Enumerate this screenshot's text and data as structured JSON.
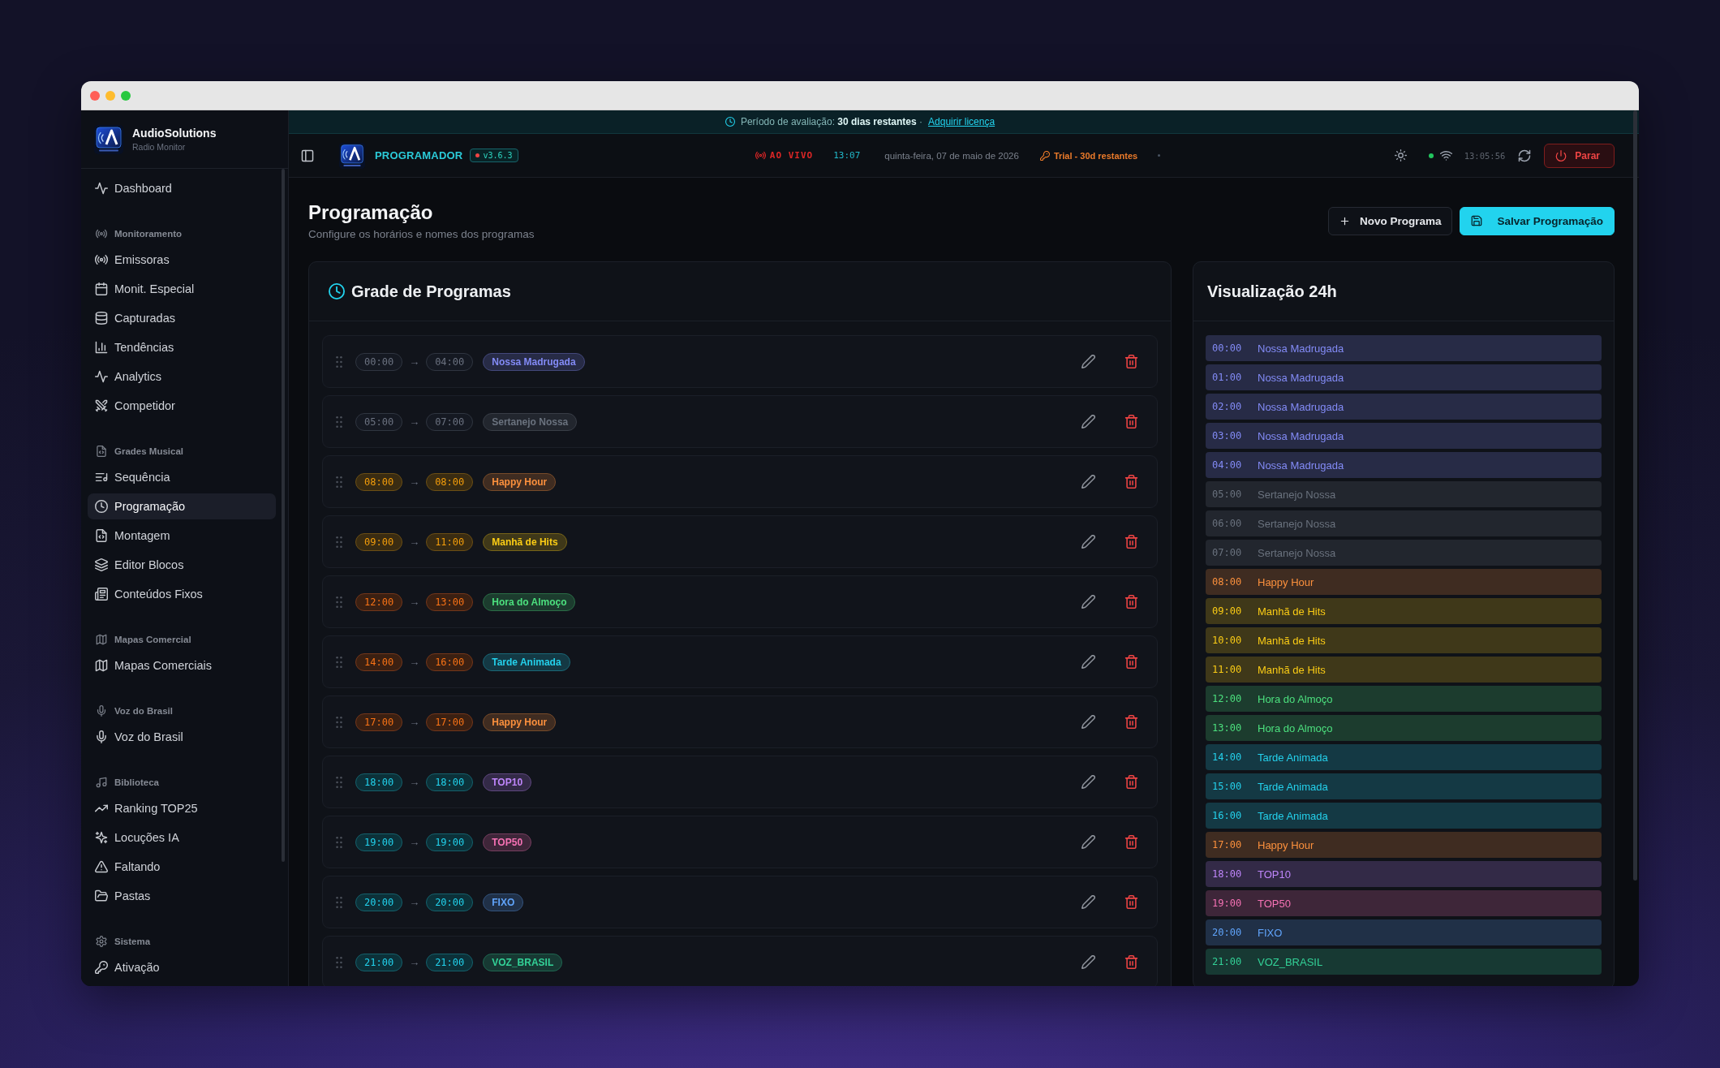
{
  "sidebar": {
    "brand": {
      "name": "AudioSolutions",
      "subtitle": "Radio Monitor"
    },
    "groups": [
      {
        "items": [
          {
            "label": "Dashboard",
            "selected": false
          }
        ]
      },
      {
        "heading": "Monitoramento",
        "items": [
          {
            "label": "Emissoras",
            "selected": false
          },
          {
            "label": "Monit. Especial",
            "selected": false
          },
          {
            "label": "Capturadas",
            "selected": false
          },
          {
            "label": "Tendências",
            "selected": false
          },
          {
            "label": "Analytics",
            "selected": false
          },
          {
            "label": "Competidor",
            "selected": false
          }
        ]
      },
      {
        "heading": "Grades Musical",
        "items": [
          {
            "label": "Sequência",
            "selected": false
          },
          {
            "label": "Programação",
            "selected": true
          },
          {
            "label": "Montagem",
            "selected": false
          },
          {
            "label": "Editor Blocos",
            "selected": false
          },
          {
            "label": "Conteúdos Fixos",
            "selected": false
          }
        ]
      },
      {
        "heading": "Mapas Comercial",
        "items": [
          {
            "label": "Mapas Comerciais",
            "selected": false
          }
        ]
      },
      {
        "heading": "Voz do Brasil",
        "items": [
          {
            "label": "Voz do Brasil",
            "selected": false
          }
        ]
      },
      {
        "heading": "Biblioteca",
        "items": [
          {
            "label": "Ranking TOP25",
            "selected": false
          },
          {
            "label": "Locuções IA",
            "selected": false
          },
          {
            "label": "Faltando",
            "selected": false
          },
          {
            "label": "Pastas",
            "selected": false
          }
        ]
      },
      {
        "heading": "Sistema",
        "items": [
          {
            "label": "Ativação",
            "selected": false
          }
        ]
      }
    ]
  },
  "trial_banner": {
    "message": "Período de avaliação: **30 dias restantes** ·",
    "link": "Adquirir licença"
  },
  "header": {
    "app_name": "PROGRAMADOR",
    "version": "v3.6.3",
    "live_label": "AO VIVO",
    "live_time": "13:07",
    "date": "quinta-feira, 07 de maio de 2026",
    "trial": "Trial - 30d restantes",
    "online": true,
    "clock": "13:05:56",
    "stop_button": "Parar"
  },
  "page": {
    "title": "Programação",
    "subtitle": "Configure os horários e nomes dos programas",
    "actions": [
      {
        "label": "Novo Programa",
        "kind": "outline"
      },
      {
        "label": "Salvar Programação",
        "kind": "filled"
      }
    ]
  },
  "schedule": {
    "title": "Grade de Programas",
    "rows": [
      {
        "start": "00:00",
        "arrow": "→",
        "end": "04:00",
        "program": "Nossa Madrugada",
        "kind": "dawn",
        "color": "#272b46"
      },
      {
        "start": "05:00",
        "arrow": "→",
        "end": "07:00",
        "program": "Sertanejo Nossa",
        "kind": "dawn",
        "color": "#22262e"
      },
      {
        "start": "08:00",
        "arrow": "→",
        "end": "08:00",
        "program": "Happy Hour",
        "kind": "morning",
        "color": "#3f2c21"
      },
      {
        "start": "09:00",
        "arrow": "→",
        "end": "11:00",
        "program": "Manhã de Hits",
        "kind": "morning",
        "color": "#3f3819"
      },
      {
        "start": "12:00",
        "arrow": "→",
        "end": "13:00",
        "program": "Hora do Almoço",
        "kind": "afternoon",
        "color": "#1c3c2e"
      },
      {
        "start": "14:00",
        "arrow": "→",
        "end": "16:00",
        "program": "Tarde Animada",
        "kind": "afternoon",
        "color": "#143944"
      },
      {
        "start": "17:00",
        "arrow": "→",
        "end": "17:00",
        "program": "Happy Hour",
        "kind": "afternoon",
        "color": "#3f2c21"
      },
      {
        "start": "18:00",
        "arrow": "→",
        "end": "18:00",
        "program": "TOP10",
        "kind": "evening",
        "color": "#332a47"
      },
      {
        "start": "19:00",
        "arrow": "→",
        "end": "19:00",
        "program": "TOP50",
        "kind": "evening",
        "color": "#3e2639"
      },
      {
        "start": "20:00",
        "arrow": "→",
        "end": "20:00",
        "program": "FIXO",
        "kind": "evening",
        "color": "#203047"
      },
      {
        "start": "21:00",
        "arrow": "→",
        "end": "21:00",
        "program": "VOZ_BRASIL",
        "kind": "evening",
        "color": "#173933"
      }
    ]
  },
  "timeline": {
    "title": "Visualização 24h",
    "slots": [
      {
        "time": "00:00",
        "program": "Nossa Madrugada",
        "color": "#272b46"
      },
      {
        "time": "01:00",
        "program": "Nossa Madrugada",
        "color": "#272b46"
      },
      {
        "time": "02:00",
        "program": "Nossa Madrugada",
        "color": "#272b46"
      },
      {
        "time": "03:00",
        "program": "Nossa Madrugada",
        "color": "#272b46"
      },
      {
        "time": "04:00",
        "program": "Nossa Madrugada",
        "color": "#272b46"
      },
      {
        "time": "05:00",
        "program": "Sertanejo Nossa",
        "color": "#22262e"
      },
      {
        "time": "06:00",
        "program": "Sertanejo Nossa",
        "color": "#22262e"
      },
      {
        "time": "07:00",
        "program": "Sertanejo Nossa",
        "color": "#22262e"
      },
      {
        "time": "08:00",
        "program": "Happy Hour",
        "color": "#3f2c21"
      },
      {
        "time": "09:00",
        "program": "Manhã de Hits",
        "color": "#3f3819"
      },
      {
        "time": "10:00",
        "program": "Manhã de Hits",
        "color": "#3f3819"
      },
      {
        "time": "11:00",
        "program": "Manhã de Hits",
        "color": "#3f3819"
      },
      {
        "time": "12:00",
        "program": "Hora do Almoço",
        "color": "#1c3c2e"
      },
      {
        "time": "13:00",
        "program": "Hora do Almoço",
        "color": "#1c3c2e"
      },
      {
        "time": "14:00",
        "program": "Tarde Animada",
        "color": "#143944"
      },
      {
        "time": "15:00",
        "program": "Tarde Animada",
        "color": "#143944"
      },
      {
        "time": "16:00",
        "program": "Tarde Animada",
        "color": "#143944"
      },
      {
        "time": "17:00",
        "program": "Happy Hour",
        "color": "#3f2c21"
      },
      {
        "time": "18:00",
        "program": "TOP10",
        "color": "#332a47"
      },
      {
        "time": "19:00",
        "program": "TOP50",
        "color": "#3e2639"
      },
      {
        "time": "20:00",
        "program": "FIXO",
        "color": "#203047"
      },
      {
        "time": "21:00",
        "program": "VOZ_BRASIL",
        "color": "#173933"
      }
    ]
  }
}
